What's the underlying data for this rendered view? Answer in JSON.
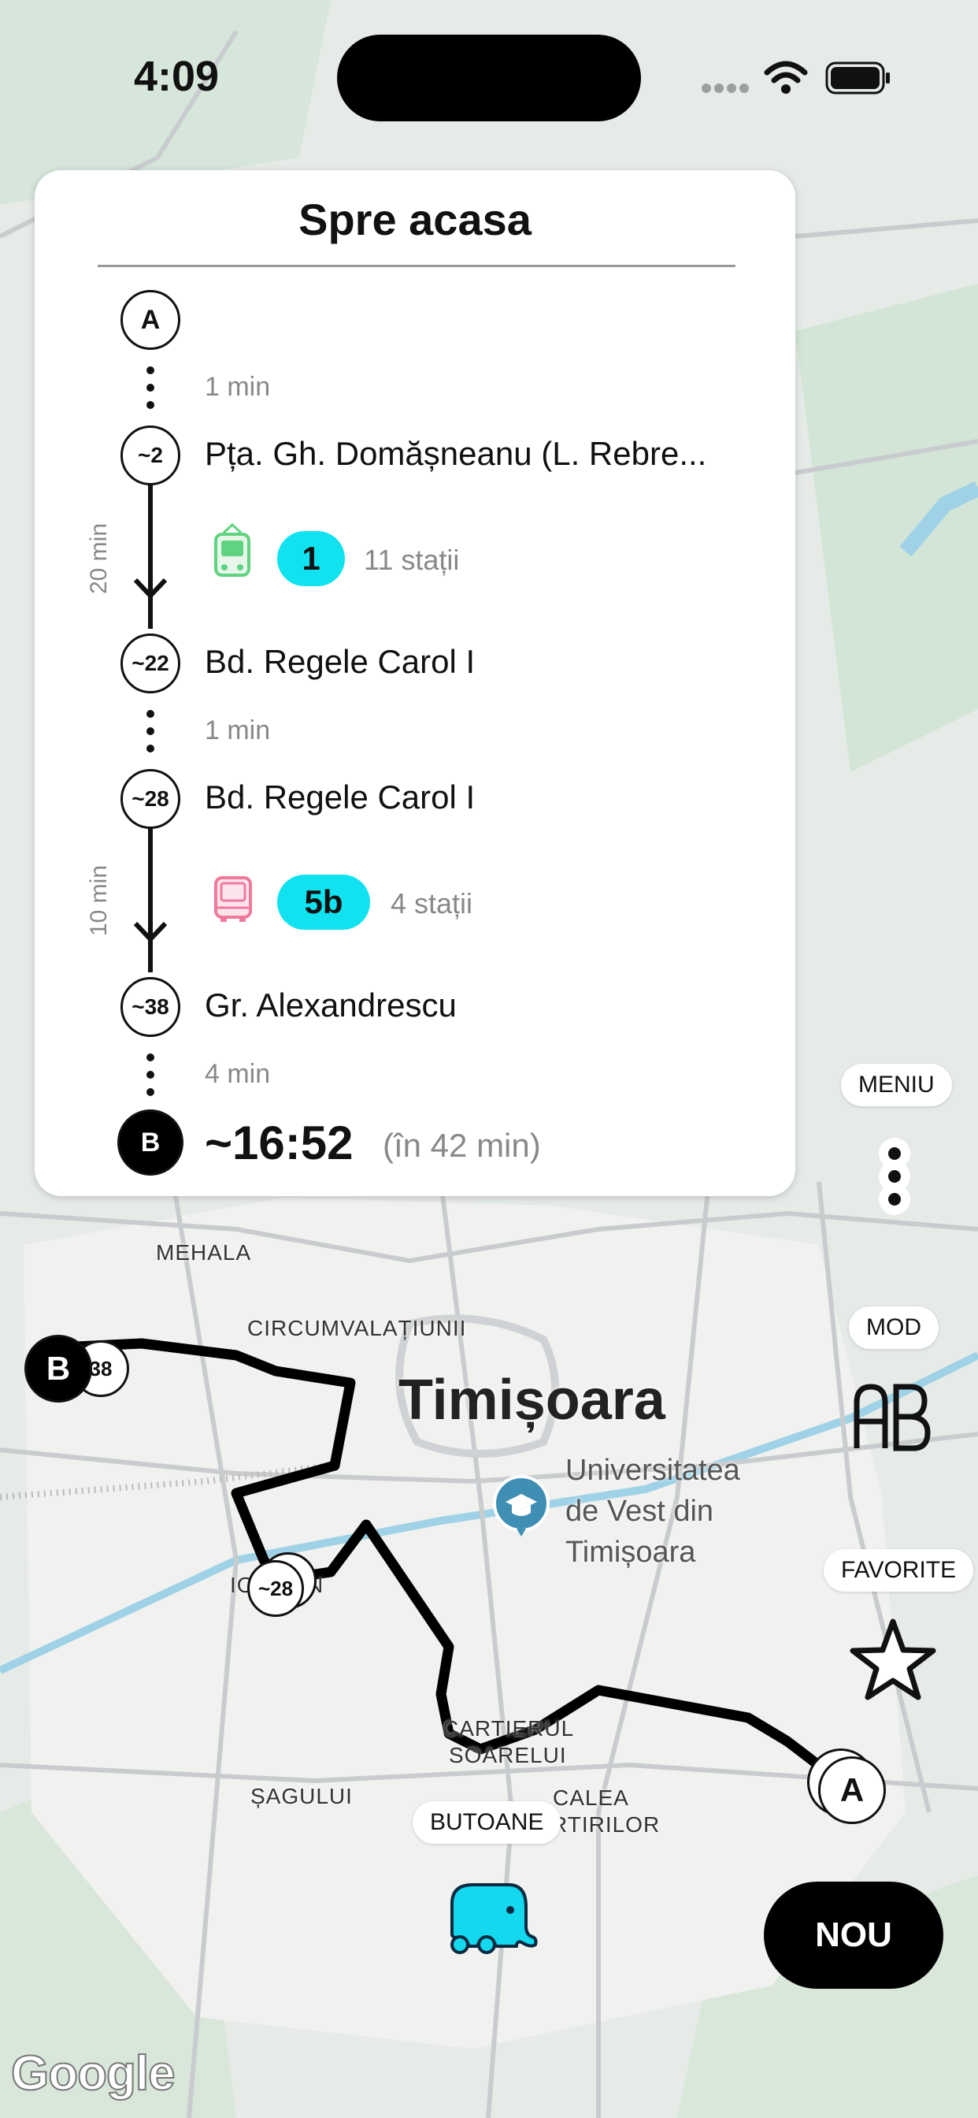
{
  "status_bar": {
    "time": "4:09"
  },
  "route": {
    "title": "Spre acasa",
    "origin": {
      "marker": "A",
      "walk": "1 min"
    },
    "legs": [
      {
        "duration": "20 min",
        "board": {
          "marker": "~2",
          "name": "Pța. Gh. Domășneanu (L. Rebre..."
        },
        "vehicle_icon": "tram-icon",
        "vehicle_color": "#5fd37f",
        "line": "1",
        "stations": "11 stații",
        "alight": {
          "marker": "~22",
          "name": "Bd. Regele Carol I"
        },
        "walk_after": "1 min"
      },
      {
        "duration": "10 min",
        "board": {
          "marker": "~28",
          "name": "Bd. Regele Carol I"
        },
        "vehicle_icon": "bus-icon",
        "vehicle_color": "#f07a9c",
        "line": "5b",
        "stations": "4 stații",
        "alight": {
          "marker": "~38",
          "name": "Gr. Alexandrescu"
        },
        "walk_after": "4 min"
      }
    ],
    "destination": {
      "marker": "B",
      "arrival": "~16:52",
      "relative": "(în 42 min)"
    },
    "line_badge_color": "#10e3ef"
  },
  "map": {
    "city": "Timișoara",
    "districts": [
      "MEHALA",
      "CIRCUMVALAȚIUNII",
      "CARTIERUL",
      "SOARELUI",
      "ȘAGULUI",
      "CALEA",
      "RTIRILOR",
      "IO",
      "N"
    ],
    "poi": [
      "Universitatea",
      "de Vest din",
      "Timișoara"
    ],
    "markers": {
      "a": "A",
      "b": "B",
      "m38": "38",
      "m28": "~28"
    },
    "attribution": "Google"
  },
  "controls": {
    "menu": "MENIU",
    "mod": "MOD",
    "favorite": "FAVORITE",
    "butoane": "BUTOANE",
    "nou": "NOU"
  }
}
